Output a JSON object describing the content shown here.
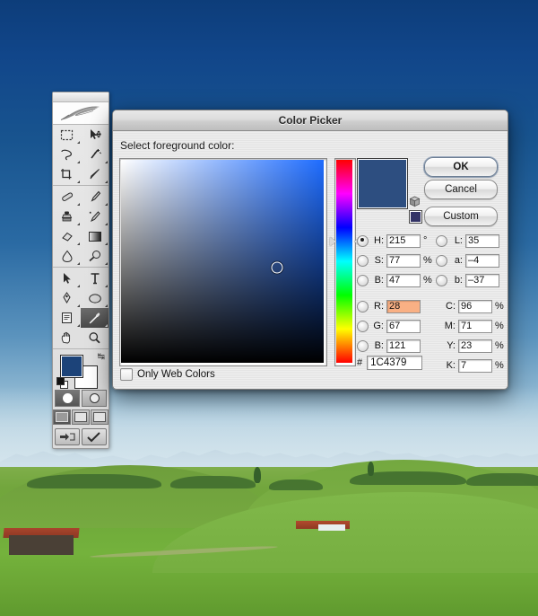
{
  "desktop": {
    "wallpaper_name": "alpine-meadow-wallpaper",
    "sky_color": "#18548f",
    "grass_color": "#74b23c"
  },
  "toolbar": {
    "name": "Photoshop Tools Palette",
    "logo": "feather-logo",
    "tools": [
      {
        "id": "marquee",
        "label": "Rectangular Marquee Tool"
      },
      {
        "id": "move",
        "label": "Move Tool"
      },
      {
        "id": "lasso",
        "label": "Lasso Tool"
      },
      {
        "id": "magic-wand",
        "label": "Magic Wand Tool"
      },
      {
        "id": "crop",
        "label": "Crop Tool"
      },
      {
        "id": "slice",
        "label": "Slice Tool"
      },
      {
        "id": "healing-brush",
        "label": "Healing Brush Tool"
      },
      {
        "id": "brush",
        "label": "Brush Tool"
      },
      {
        "id": "clone-stamp",
        "label": "Clone Stamp Tool"
      },
      {
        "id": "history-brush",
        "label": "History Brush Tool"
      },
      {
        "id": "eraser",
        "label": "Eraser Tool"
      },
      {
        "id": "gradient",
        "label": "Gradient Tool"
      },
      {
        "id": "blur",
        "label": "Blur Tool"
      },
      {
        "id": "dodge",
        "label": "Dodge Tool"
      },
      {
        "id": "path-selection",
        "label": "Path Selection Tool"
      },
      {
        "id": "type",
        "label": "Horizontal Type Tool"
      },
      {
        "id": "pen",
        "label": "Pen Tool"
      },
      {
        "id": "shape",
        "label": "Ellipse Shape Tool"
      },
      {
        "id": "notes",
        "label": "Notes Tool"
      },
      {
        "id": "eyedropper",
        "label": "Eyedropper Tool",
        "selected": true
      },
      {
        "id": "hand",
        "label": "Hand Tool"
      },
      {
        "id": "zoom",
        "label": "Zoom Tool"
      }
    ],
    "foreground_color": "#1C4379",
    "background_color": "#FFFFFF",
    "swap_label": "↹",
    "quickmask": {
      "standard_label": "Edit in Standard Mode",
      "quickmask_label": "Edit in Quick Mask Mode"
    },
    "screen_modes": [
      {
        "id": "standard-screen-mode",
        "label": "Standard Screen Mode",
        "active": true
      },
      {
        "id": "full-screen-menubar",
        "label": "Full Screen Mode With Menu Bar",
        "active": false
      },
      {
        "id": "full-screen",
        "label": "Full Screen Mode",
        "active": false
      }
    ],
    "jump_to": "Jump to ImageReady"
  },
  "picker": {
    "title": "Color Picker",
    "prompt": "Select foreground color:",
    "buttons": {
      "ok": "OK",
      "cancel": "Cancel",
      "custom": "Custom"
    },
    "preview_color": "#2D4E80",
    "web_safe_color": "#333366",
    "cube_icon": "web-safe-cube-icon",
    "sv_field": {
      "hue_color": "#1e6cff",
      "marker_x_pct": 77,
      "marker_y_pct": 53
    },
    "hue_slider": {
      "marker_y_pct": 40.2
    },
    "hsb": [
      {
        "id": "H",
        "label": "H:",
        "value": "215",
        "unit": "°",
        "selected": true
      },
      {
        "id": "S",
        "label": "S:",
        "value": "77",
        "unit": "%",
        "selected": false
      },
      {
        "id": "B",
        "label": "B:",
        "value": "47",
        "unit": "%",
        "selected": false
      }
    ],
    "lab": [
      {
        "id": "L",
        "label": "L:",
        "value": "35",
        "unit": "",
        "selected": false
      },
      {
        "id": "a",
        "label": "a:",
        "value": "–4",
        "unit": "",
        "selected": false
      },
      {
        "id": "b",
        "label": "b:",
        "value": "–37",
        "unit": "",
        "selected": false
      }
    ],
    "rgb": [
      {
        "id": "R",
        "label": "R:",
        "value": "28",
        "unit": "",
        "selected": false,
        "highlighted": true
      },
      {
        "id": "G",
        "label": "G:",
        "value": "67",
        "unit": "",
        "selected": false,
        "highlighted": false
      },
      {
        "id": "B2",
        "label": "B:",
        "value": "121",
        "unit": "",
        "selected": false,
        "highlighted": false
      }
    ],
    "cmyk": [
      {
        "id": "C",
        "label": "C:",
        "value": "96",
        "unit": "%"
      },
      {
        "id": "M",
        "label": "M:",
        "value": "71",
        "unit": "%"
      },
      {
        "id": "Y",
        "label": "Y:",
        "value": "23",
        "unit": "%"
      },
      {
        "id": "K",
        "label": "K:",
        "value": "7",
        "unit": "%"
      }
    ],
    "hex": {
      "prefix": "#",
      "value": "1C4379"
    },
    "only_web_colors": {
      "label": "Only Web Colors",
      "checked": false
    }
  }
}
